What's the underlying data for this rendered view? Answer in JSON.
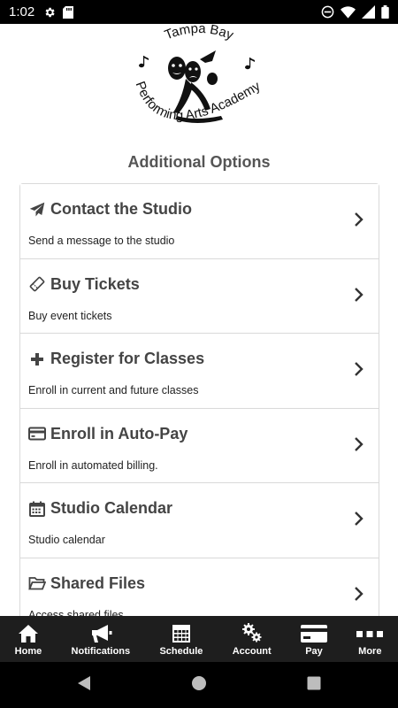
{
  "status_bar": {
    "time": "1:02",
    "left_icons": [
      "gear-icon",
      "sd-card-icon"
    ],
    "right_icons": [
      "do-not-disturb-icon",
      "wifi-icon",
      "signal-icon",
      "battery-icon"
    ]
  },
  "logo": {
    "text_top": "Tampa Bay",
    "text_bottom": "Performing Arts Academy"
  },
  "page": {
    "title": "Additional Options"
  },
  "options": [
    {
      "icon": "paper-plane-icon",
      "title": "Contact the Studio",
      "description": "Send a message to the studio"
    },
    {
      "icon": "ticket-icon",
      "title": "Buy Tickets",
      "description": "Buy event tickets"
    },
    {
      "icon": "plus-icon",
      "title": "Register for Classes",
      "description": "Enroll in current and future classes"
    },
    {
      "icon": "credit-card-icon",
      "title": "Enroll in Auto-Pay",
      "description": "Enroll in automated billing."
    },
    {
      "icon": "calendar-icon",
      "title": "Studio Calendar",
      "description": "Studio calendar"
    },
    {
      "icon": "folder-icon",
      "title": "Shared Files",
      "description": "Access shared files"
    }
  ],
  "bottom_nav": [
    {
      "icon": "home-icon",
      "label": "Home"
    },
    {
      "icon": "megaphone-icon",
      "label": "Notifications"
    },
    {
      "icon": "schedule-icon",
      "label": "Schedule"
    },
    {
      "icon": "gears-icon",
      "label": "Account"
    },
    {
      "icon": "pay-icon",
      "label": "Pay"
    },
    {
      "icon": "more-icon",
      "label": "More"
    }
  ],
  "colors": {
    "nav_background": "#1e1e1e",
    "title_text": "#555555",
    "option_title": "#444444",
    "border": "#d9d9d9"
  }
}
